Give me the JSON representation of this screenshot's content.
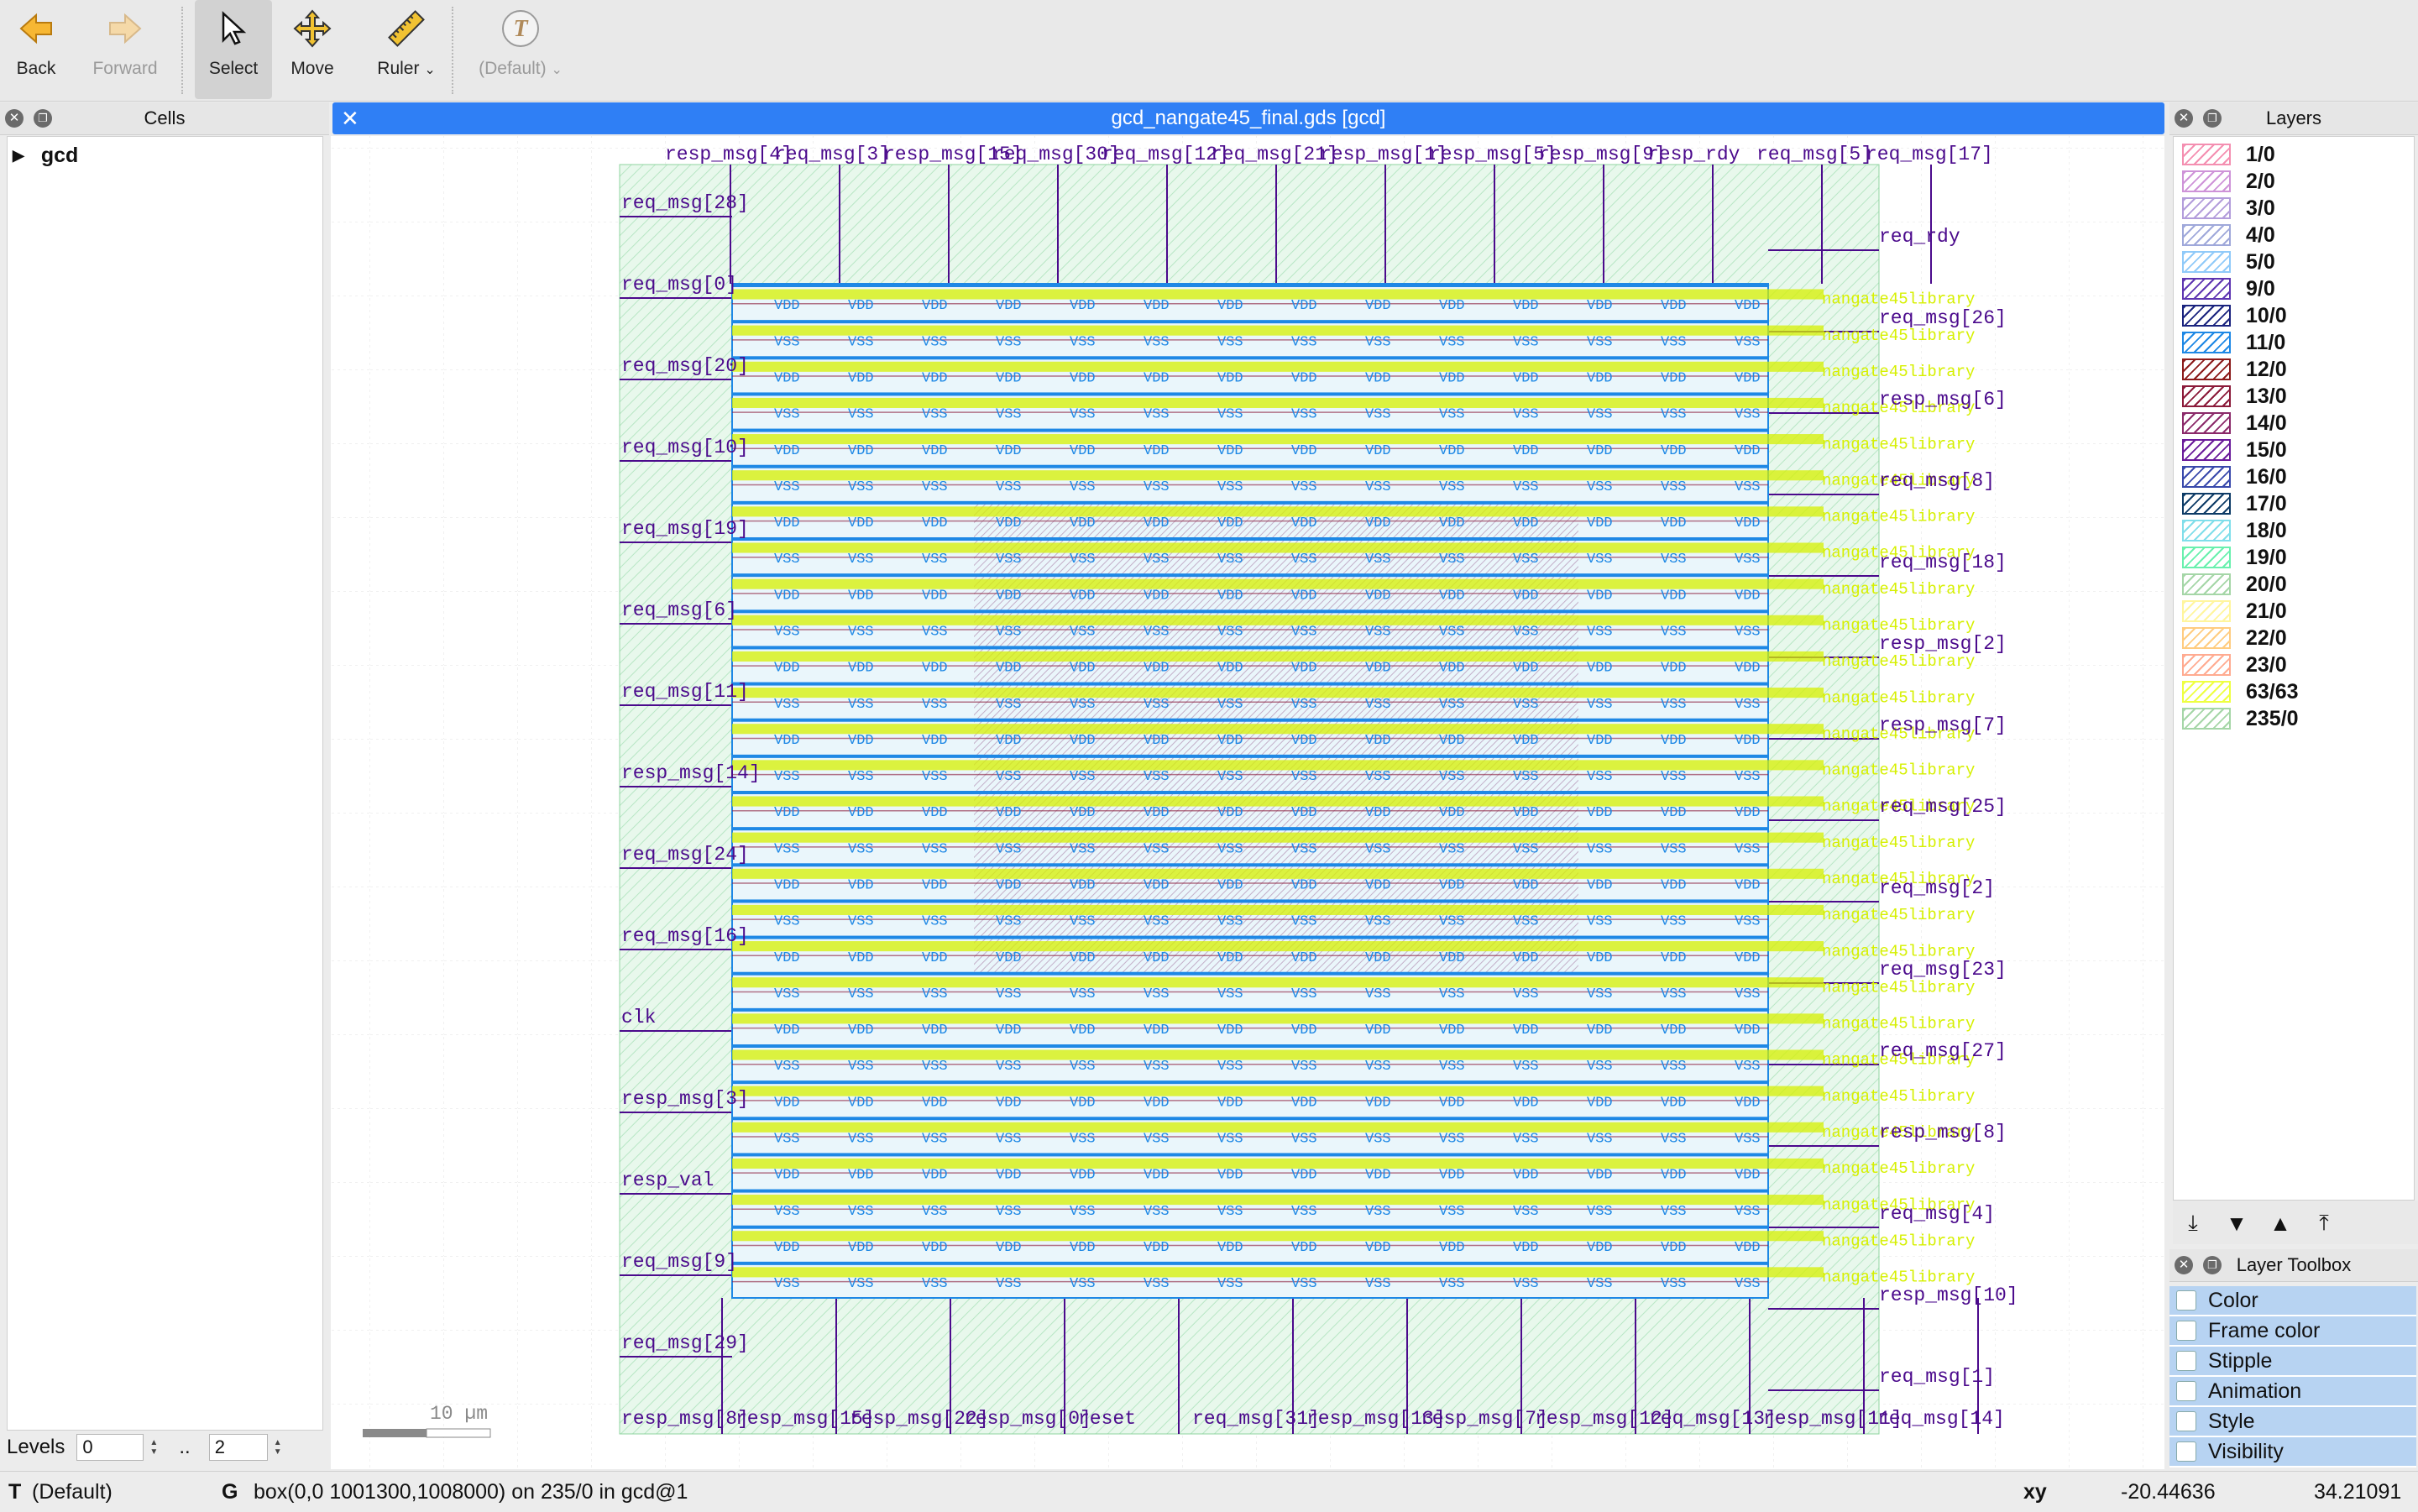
{
  "toolbar": {
    "back": "Back",
    "forward": "Forward",
    "select": "Select",
    "move": "Move",
    "ruler": "Ruler",
    "text_style": "(Default)"
  },
  "cells_panel": {
    "title": "Cells",
    "root_cell": "gcd",
    "levels_label": "Levels",
    "levels_from": "0",
    "levels_sep": "..",
    "levels_to": "2"
  },
  "view": {
    "tab_title": "gcd_nangate45_final.gds [gcd]",
    "scale_label": "10 µm"
  },
  "pins": {
    "top": [
      "resp_msg[4]",
      "req_msg[3]",
      "resp_msg[15]",
      "req_msg[30]",
      "req_msg[12]",
      "req_msg[21]",
      "resp_msg[1]",
      "resp_msg[5]",
      "resp_msg[9]",
      "resp_rdy",
      "req_msg[5]",
      "req_msg[17]"
    ],
    "left": [
      "req_msg[28]",
      "req_msg[0]",
      "req_msg[20]",
      "req_msg[10]",
      "req_msg[19]",
      "req_msg[6]",
      "req_msg[11]",
      "resp_msg[14]",
      "req_msg[24]",
      "req_msg[16]",
      "clk",
      "resp_msg[3]",
      "resp_val",
      "req_msg[9]",
      "req_msg[29]"
    ],
    "right": [
      "req_rdy",
      "req_msg[26]",
      "resp_msg[6]",
      "req_msg[8]",
      "req_msg[18]",
      "resp_msg[2]",
      "resp_msg[7]",
      "req_msg[25]",
      "req_msg[2]",
      "req_msg[23]",
      "req_msg[27]",
      "resp_msg[8]",
      "req_msg[4]",
      "resp_msg[10]",
      "req_msg[1]"
    ],
    "bottom": [
      "resp_msg[8]",
      "resp_msg[15]",
      "resp_msg[22]",
      "resp_msg[0]",
      "reset",
      "req_msg[31]",
      "resp_msg[13]",
      "resp_msg[7]",
      "resp_msg[12]",
      "req_msg[13]",
      "resp_msg[11]",
      "req_msg[14]"
    ]
  },
  "cell_labels": {
    "vdd": "VDD",
    "vss": "VSS",
    "overflow": "nangate45library"
  },
  "colors": {
    "accent": "#2f7ff5",
    "pin_text": "#4b0a8c",
    "overlay_yellow": "#d6f000",
    "row_blue": "#1e88e5",
    "route_red": "#8b1a3a",
    "background_green": "#dff5e4"
  },
  "layers_panel": {
    "title": "Layers",
    "layers": [
      {
        "name": "1/0",
        "color": "#f48fb1"
      },
      {
        "name": "2/0",
        "color": "#ce93d8"
      },
      {
        "name": "3/0",
        "color": "#b39ddb"
      },
      {
        "name": "4/0",
        "color": "#9fa8da"
      },
      {
        "name": "5/0",
        "color": "#90caf9"
      },
      {
        "name": "9/0",
        "color": "#5e35b1"
      },
      {
        "name": "10/0",
        "color": "#1a237e"
      },
      {
        "name": "11/0",
        "color": "#1e88e5"
      },
      {
        "name": "12/0",
        "color": "#8b1a1a"
      },
      {
        "name": "13/0",
        "color": "#8b1a3a"
      },
      {
        "name": "14/0",
        "color": "#8b2a6a"
      },
      {
        "name": "15/0",
        "color": "#6a1b9a"
      },
      {
        "name": "16/0",
        "color": "#3949ab"
      },
      {
        "name": "17/0",
        "color": "#0d3b66"
      },
      {
        "name": "18/0",
        "color": "#80deea"
      },
      {
        "name": "19/0",
        "color": "#69f0ae"
      },
      {
        "name": "20/0",
        "color": "#a5d6a7"
      },
      {
        "name": "21/0",
        "color": "#fff59d"
      },
      {
        "name": "22/0",
        "color": "#ffcc80"
      },
      {
        "name": "23/0",
        "color": "#ffab91"
      },
      {
        "name": "63/63",
        "color": "#eeff41"
      },
      {
        "name": "235/0",
        "color": "#a5d6a7"
      }
    ]
  },
  "layer_toolbox": {
    "title": "Layer Toolbox",
    "items": [
      "Color",
      "Frame color",
      "Stipple",
      "Animation",
      "Style",
      "Visibility"
    ]
  },
  "status": {
    "mode": "T",
    "mode_value": "(Default)",
    "g": "G",
    "selection": "box(0,0 1001300,1008000) on 235/0 in gcd@1",
    "xy_label": "xy",
    "x": "-20.44636",
    "y": "34.21091"
  }
}
